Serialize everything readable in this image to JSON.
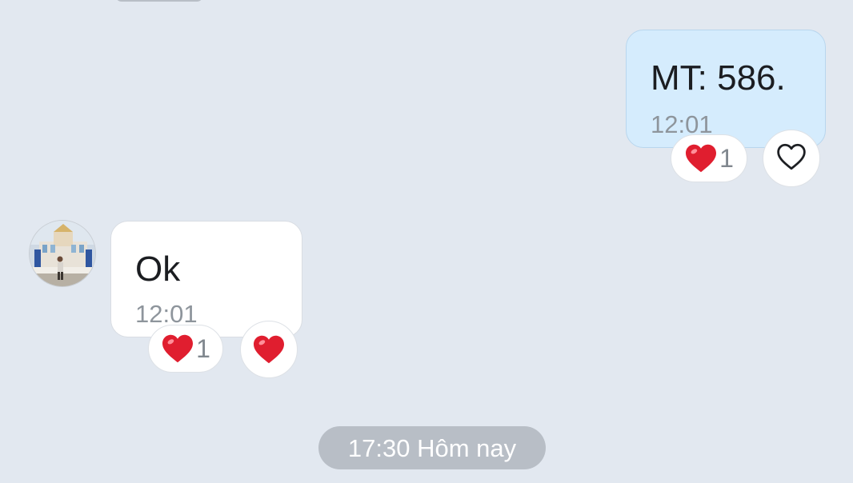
{
  "messages": [
    {
      "direction": "outgoing",
      "text": "MT: 586.",
      "time": "12:01",
      "reaction": {
        "icon": "heart-icon",
        "count": "1"
      }
    },
    {
      "direction": "incoming",
      "text": "Ok",
      "time": "12:01",
      "reaction": {
        "icon": "heart-icon",
        "count": "1"
      }
    }
  ],
  "date_separator": "17:30 Hôm nay",
  "colors": {
    "background": "#e2e8f0",
    "outgoing_bubble": "#d5ecfd",
    "incoming_bubble": "#ffffff",
    "heart": "#e01e2f",
    "separator_pill": "#b8bec6"
  }
}
